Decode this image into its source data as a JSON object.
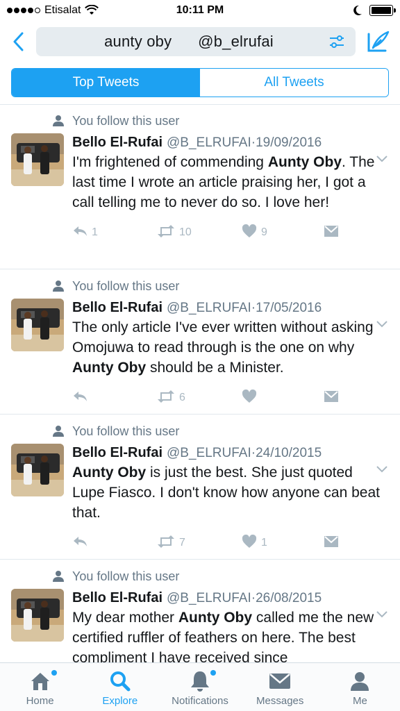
{
  "status_bar": {
    "carrier": "Etisalat",
    "time": "10:11 PM"
  },
  "search": {
    "query": "aunty oby      @b_elrufai"
  },
  "tabs": {
    "top": "Top Tweets",
    "all": "All Tweets"
  },
  "tweets": [
    {
      "context": "You follow this user",
      "name": "Bello El-Rufai",
      "handle": "@B_ELRUFAI",
      "date": "19/09/2016",
      "text_before": "I'm frightened of commending ",
      "text_bold": "Aunty Oby",
      "text_after": ". The last time I wrote an article praising her, I got a call telling me to never do so. I love her!",
      "replies": "1",
      "retweets": "10",
      "likes": "9"
    },
    {
      "context": "You follow this user",
      "name": "Bello El-Rufai",
      "handle": "@B_ELRUFAI",
      "date": "17/05/2016",
      "text_before": "The only article I've ever written without asking Omojuwa to read through is the one on why ",
      "text_bold": "Aunty Oby",
      "text_after": " should be a Minister.",
      "replies": "",
      "retweets": "6",
      "likes": ""
    },
    {
      "context": "You follow this user",
      "name": "Bello El-Rufai",
      "handle": "@B_ELRUFAI",
      "date": "24/10/2015",
      "text_before": "",
      "text_bold": "Aunty Oby",
      "text_after": " is just the best. She just quoted Lupe Fiasco. I don't know how anyone can beat that.",
      "replies": "",
      "retweets": "7",
      "likes": "1"
    },
    {
      "context": "You follow this user",
      "name": "Bello El-Rufai",
      "handle": "@B_ELRUFAI",
      "date": "26/08/2015",
      "text_before": "My dear mother ",
      "text_bold": "Aunty Oby",
      "text_after": " called me the new certified ruffler of feathers on here. The best compliment I have received since",
      "replies": "",
      "retweets": "",
      "likes": ""
    }
  ],
  "tab_bar": {
    "home": "Home",
    "explore": "Explore",
    "notifications": "Notifications",
    "messages": "Messages",
    "me": "Me"
  },
  "colors": {
    "accent": "#1da1f2",
    "muted": "#657786",
    "icon_gray": "#aab8c2"
  }
}
